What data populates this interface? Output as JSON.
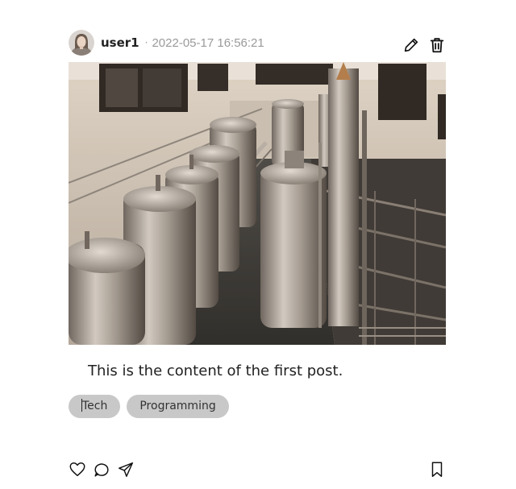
{
  "post": {
    "author": "user1",
    "separator": "·",
    "timestamp": "2022-05-17 16:56:21",
    "content": "This is the content of the first post.",
    "tags": [
      "Tech",
      "Programming"
    ]
  },
  "icons": {
    "edit": "pencil-icon",
    "delete": "trash-icon",
    "like": "heart-icon",
    "comment": "comment-icon",
    "share": "send-icon",
    "save": "bookmark-icon"
  },
  "colors": {
    "tag_background": "#c8c8c8",
    "timestamp": "#9a9a9a",
    "text": "#222222"
  }
}
